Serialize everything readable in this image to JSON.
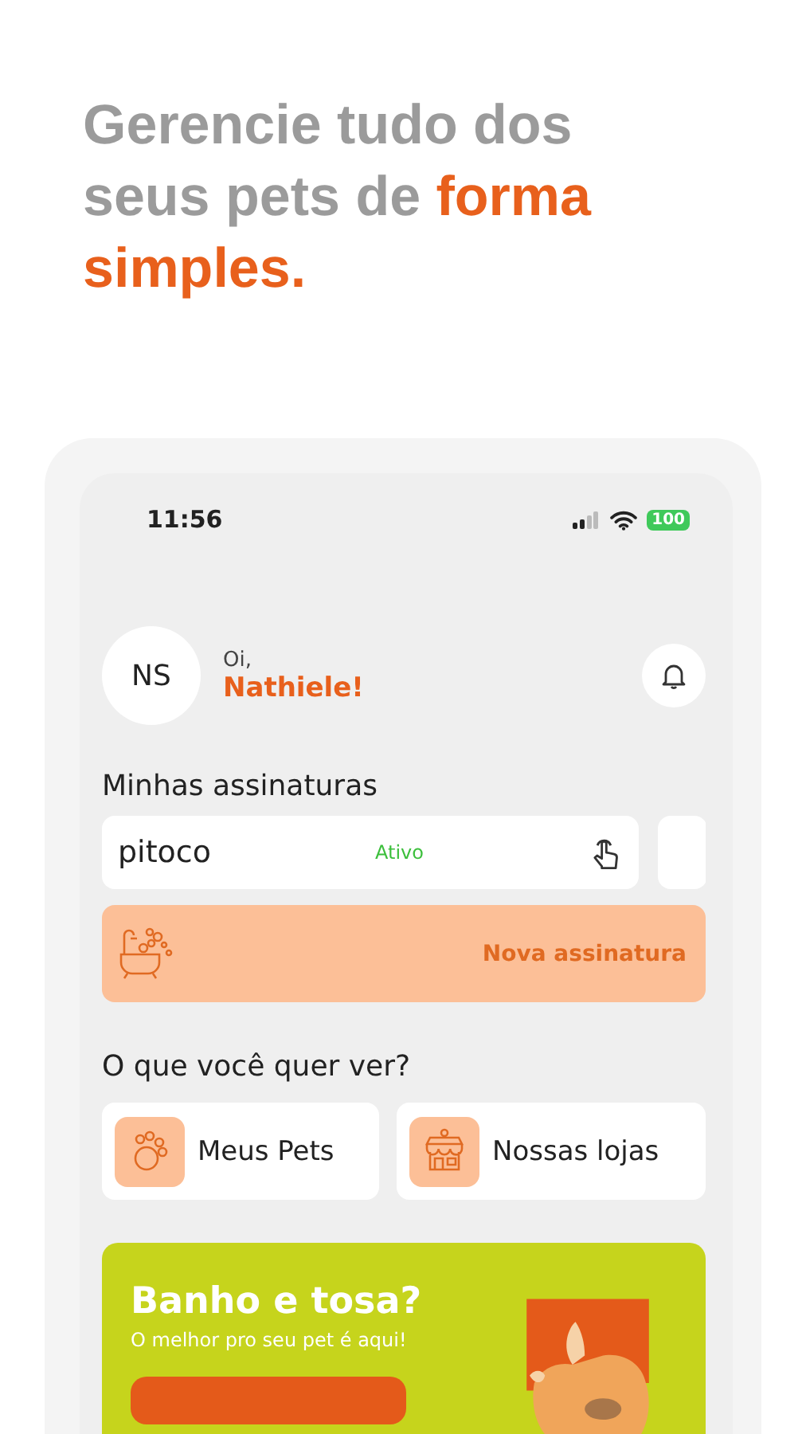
{
  "headline": {
    "lead": "Gerencie tudo dos seus pets de",
    "accent": "forma simples."
  },
  "status_bar": {
    "time": "11:56",
    "battery": "100"
  },
  "greeting": {
    "initials": "NS",
    "salutation": "Oi,",
    "name": "Nathiele!"
  },
  "subscriptions": {
    "title": "Minhas assinaturas",
    "items": [
      {
        "pet": "pitoco",
        "status": "Ativo"
      }
    ],
    "new_label": "Nova assinatura"
  },
  "shortcuts": {
    "title": "O que você quer ver?",
    "items": [
      {
        "kind": "paw",
        "label": "Meus Pets"
      },
      {
        "kind": "store",
        "label": "Nossas lojas"
      }
    ]
  },
  "banner": {
    "title": "Banho e tosa?",
    "subtitle": "O melhor pro seu pet é aqui!"
  }
}
